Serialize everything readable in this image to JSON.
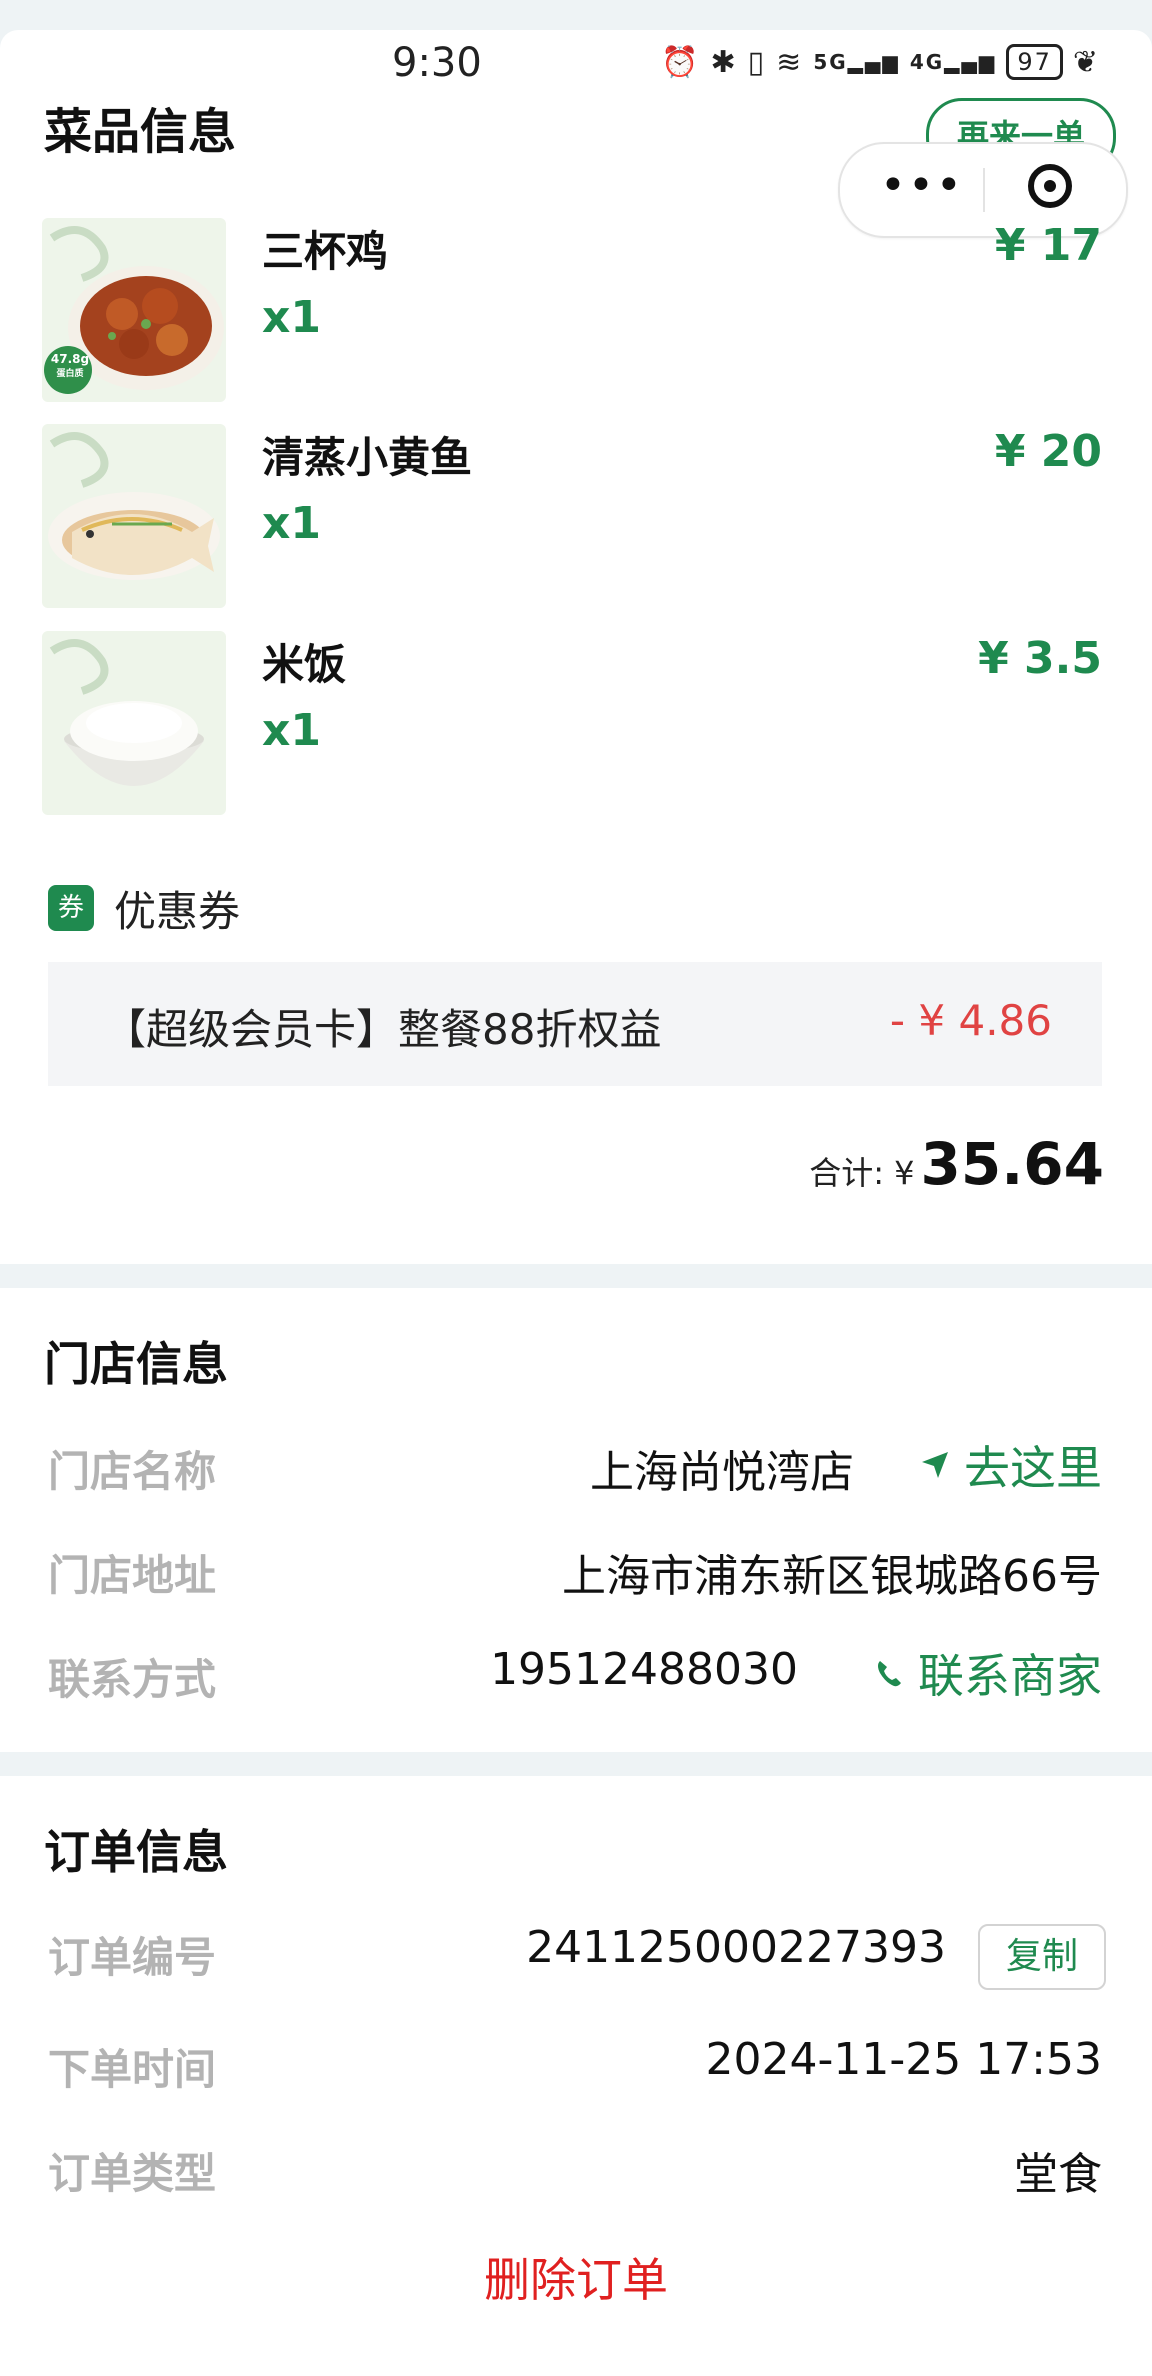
{
  "status_bar": {
    "time": "9:30",
    "battery": "97",
    "signal_text": "5G",
    "signal_text_2": "4G"
  },
  "header": {
    "title": "菜品信息",
    "reorder_label": "再来一单"
  },
  "dishes": [
    {
      "name": "三杯鸡",
      "qty": "x1",
      "price": "¥ 17",
      "badge_value": "47.8g",
      "badge_label": "蛋白质"
    },
    {
      "name": "清蒸小黄鱼",
      "qty": "x1",
      "price": "¥ 20"
    },
    {
      "name": "米饭",
      "qty": "x1",
      "price": "¥ 3.5"
    }
  ],
  "coupon": {
    "badge": "券",
    "title": "优惠券",
    "description": "【超级会员卡】整餐88折权益",
    "amount": "- ¥ 4.86"
  },
  "total": {
    "label": "合计: ¥",
    "value": "35.64"
  },
  "store": {
    "title": "门店信息",
    "name_label": "门店名称",
    "name": "上海尚悦湾店",
    "navigate_label": "去这里",
    "address_label": "门店地址",
    "address": "上海市浦东新区银城路66号",
    "contact_label": "联系方式",
    "phone": "19512488030",
    "contact_link": "联系商家"
  },
  "order": {
    "title": "订单信息",
    "number_label": "订单编号",
    "number": "241125000227393",
    "copy_label": "复制",
    "time_label": "下单时间",
    "time": "2024-11-25 17:53",
    "type_label": "订单类型",
    "type": "堂食",
    "delete_label": "删除订单"
  },
  "colors": {
    "brand_green": "#1f8a4f",
    "discount_red": "#e04343",
    "delete_red": "#e02020",
    "section_bg": "#eef3f5"
  }
}
